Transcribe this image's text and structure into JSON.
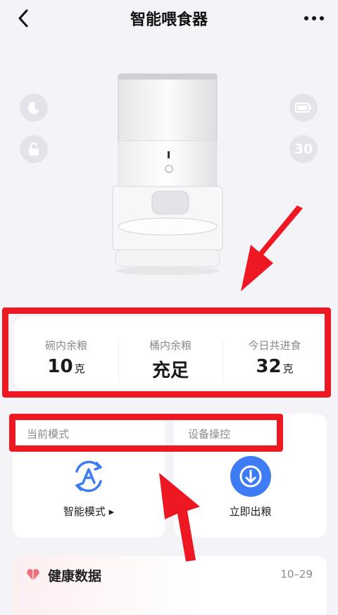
{
  "header": {
    "title": "智能喂食器"
  },
  "side_buttons": {
    "battery_level": "30"
  },
  "stats": [
    {
      "label": "碗内余粮",
      "value": "10",
      "unit": "克"
    },
    {
      "label": "桶内余粮",
      "value": "充足",
      "unit": ""
    },
    {
      "label": "今日共进食",
      "value": "32",
      "unit": "克"
    }
  ],
  "mode_card": {
    "title": "当前模式",
    "label": "智能模式 ▸"
  },
  "control_card": {
    "title": "设备操控",
    "label": "立即出粮"
  },
  "health": {
    "title": "健康数据",
    "date": "10–29"
  },
  "colors": {
    "accent": "#3e7cf5",
    "annotation_red": "#ee1822",
    "heart": "#ee6f7c"
  }
}
